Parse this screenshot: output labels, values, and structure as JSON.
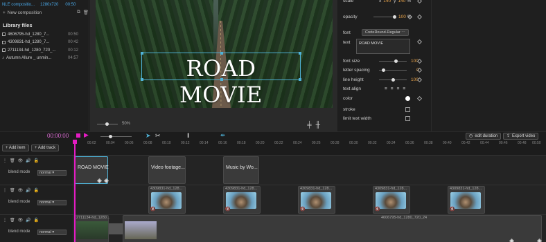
{
  "composition": {
    "name": "NLE compositio...",
    "resolution": "1280x720",
    "duration": "00:50"
  },
  "new_composition_label": "New composition",
  "library": {
    "title": "Library files",
    "items": [
      {
        "name": "4606795-hd_1280_7...",
        "duration": "00:50"
      },
      {
        "name": "4309831-hd_1280_7...",
        "duration": "00:42"
      },
      {
        "name": "2711134-hd_1280_720_...",
        "duration": "00:12"
      },
      {
        "name": "Autumn Allure _ unmin...",
        "duration": "04:57"
      }
    ]
  },
  "preview": {
    "title_text": "ROAD MOVIE",
    "zoom": "50%"
  },
  "properties": {
    "scale_label": "scale",
    "scale_x_prefix": "x",
    "scale_x": "140",
    "scale_y_prefix": "y",
    "scale_y": "140",
    "scale_unit": "%",
    "opacity_label": "opacity",
    "opacity_value": "100",
    "opacity_unit": "%",
    "font_label": "font",
    "font_value": "CreteRound-Regular",
    "text_label": "text",
    "text_value": "ROAD MOVIE",
    "font_size_label": "font size",
    "font_size_value": "100",
    "letter_spacing_label": "letter spacing",
    "letter_spacing_value": "0",
    "line_height_label": "line height",
    "line_height_value": "100",
    "text_align_label": "text align",
    "color_label": "color",
    "color_value": "#ffffff",
    "stroke_label": "stroke",
    "limit_label": "limit text width"
  },
  "toolbar": {
    "time": "00:00:00",
    "edit_duration": "edit duration",
    "export_video": "Export video",
    "add_item": "+ Add item",
    "add_track": "+ Add track"
  },
  "ruler": [
    "00:02",
    "00:04",
    "00:06",
    "00:08",
    "00:10",
    "00:12",
    "00:14",
    "00:16",
    "00:18",
    "00:20",
    "00:22",
    "00:24",
    "00:26",
    "00:28",
    "00:30",
    "00:32",
    "00:34",
    "00:36",
    "00:38",
    "00:40",
    "00:42",
    "00:44",
    "00:46",
    "00:48",
    "00:50"
  ],
  "tracks": [
    {
      "blend_label": "blend mode",
      "blend_value": "normal",
      "clips": [
        "ROAD MOVIE",
        "Video footage...",
        "Music by Wo..."
      ]
    },
    {
      "blend_label": "blend mode",
      "blend_value": "normal",
      "clip_name": "4309831-hd_128..."
    },
    {
      "blend_label": "blend mode",
      "blend_value": "normal",
      "clip_a": "2711134-hd_1280...",
      "clip_b": "4606795-hd_1280_720_24"
    }
  ]
}
